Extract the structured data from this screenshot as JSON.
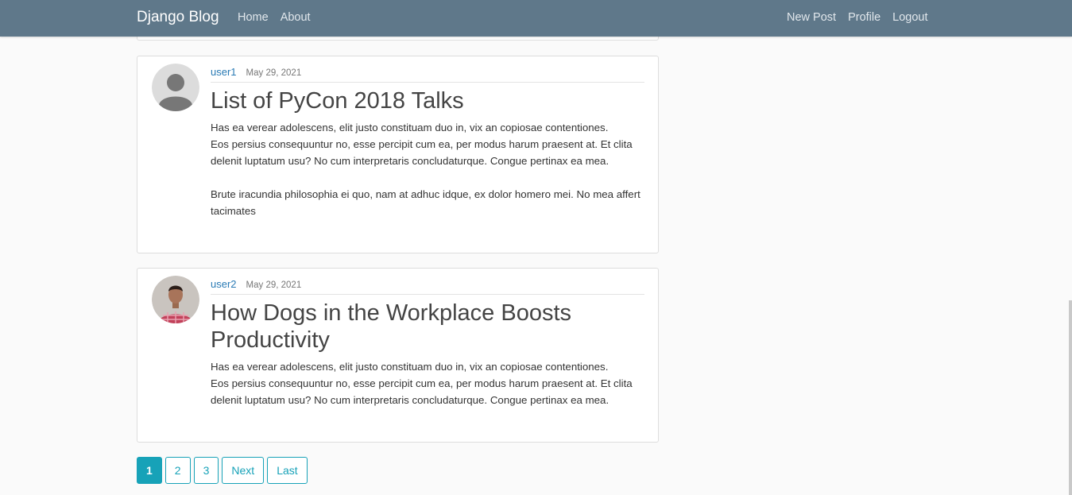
{
  "navbar": {
    "brand": "Django Blog",
    "left_links": [
      "Home",
      "About"
    ],
    "right_links": [
      "New Post",
      "Profile",
      "Logout"
    ],
    "color": "#5f788a"
  },
  "posts": [
    {
      "author": "user1",
      "date": "May 29, 2021",
      "title": "List of PyCon 2018 Talks",
      "content": "Has ea verear adolescens, elit justo constituam duo in, vix an copiosae contentiones.\nEos persius consequuntur no, esse percipit cum ea, per modus harum praesent at. Et clita delenit luptatum usu? No cum interpretaris concludaturque. Congue pertinax ea mea.\n\nBrute iracundia philosophia ei quo, nam at adhuc idque, ex dolor homero mei. No mea affert tacimates",
      "avatar": "default-avatar-icon"
    },
    {
      "author": "user2",
      "date": "May 29, 2021",
      "title": "How Dogs in the Workplace Boosts Productivity",
      "content": "Has ea verear adolescens, elit justo constituam duo in, vix an copiosae contentiones.\nEos persius consequuntur no, esse percipit cum ea, per modus harum praesent at. Et clita delenit luptatum usu? No cum interpretaris concludaturque. Congue pertinax ea mea.",
      "avatar": "user-photo"
    }
  ],
  "pagination": {
    "pages": [
      "1",
      "2",
      "3"
    ],
    "next": "Next",
    "last": "Last",
    "current": "1",
    "accent": "#17a2b8"
  }
}
